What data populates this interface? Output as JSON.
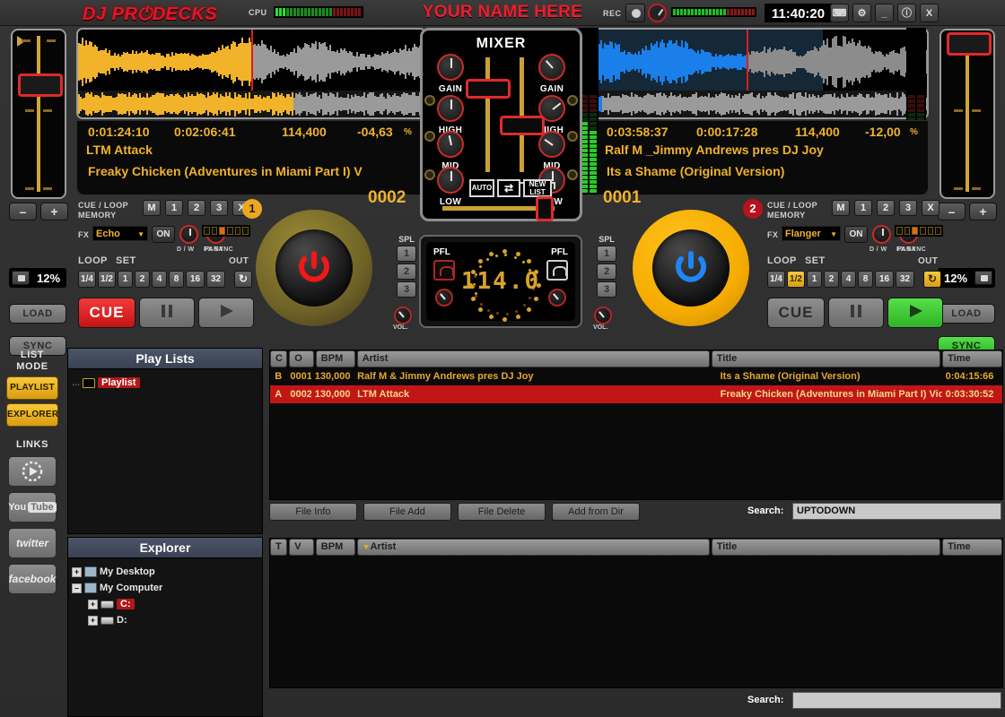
{
  "header": {
    "logo": "DJ PRഠDECKS",
    "logo_text": "DJ PRODECKS",
    "cpu_label": "CPU",
    "your_name": "YOUR NAME HERE",
    "rec_label": "REC",
    "clock": "11:40:20",
    "win_buttons": [
      "⌨",
      "⚙",
      "_",
      "ⓘ",
      "X"
    ],
    "win_button_names": [
      "keyboard-icon",
      "gear-icon",
      "minimize-icon",
      "info-icon",
      "close-icon"
    ]
  },
  "colors": {
    "accent_red": "#e8152a",
    "accent_amber": "#f0b32a",
    "deck_a_wave": "#f0b32a",
    "deck_b_wave": "#1a7fe8",
    "green_on": "#2fb227",
    "selection_red": "#c21616"
  },
  "deck_a": {
    "badge": "1",
    "elapsed": "0:01:24:10",
    "remain": "0:02:06:41",
    "bpm": "114,400",
    "pitch": "-04,63",
    "pitch_unit": "%",
    "artist": "LTM Attack",
    "title": "Freaky Chicken (Adventures in Miami Part I) V",
    "track_number": "0002",
    "pitch_lock": "12%",
    "load_label": "LOAD",
    "sync_label": "SYNC",
    "sync_active": false,
    "minus": "–",
    "plus": "+",
    "cue_loop_label": "CUE / LOOP\nMEMORY",
    "memory_buttons": [
      "M",
      "1",
      "2",
      "3",
      "X"
    ],
    "fx_label": "FX",
    "fx_name": "Echo",
    "fx_on": "ON",
    "fx_dw": "D / W",
    "fx_para": "PARA",
    "fx_sync": "FX SYNC",
    "loop_label": "LOOP",
    "set_label": "SET",
    "out_label": "OUT",
    "loop_buttons": [
      "1/4",
      "1/2",
      "1",
      "2",
      "4",
      "8",
      "16",
      "32"
    ],
    "loop_active": null,
    "cue_label": "CUE",
    "cue_active": true,
    "pause_label": "‖",
    "play_label": "▶",
    "play_active": false,
    "spl_label": "SPL",
    "spl_buttons": [
      "1",
      "2",
      "3"
    ],
    "vol_label": "VOL."
  },
  "deck_b": {
    "badge": "2",
    "elapsed": "0:03:58:37",
    "remain": "0:00:17:28",
    "bpm": "114,400",
    "pitch": "-12,00",
    "pitch_unit": "%",
    "artist": "Ralf M _Jimmy Andrews pres DJ Joy",
    "title": "Its a Shame (Original Version)",
    "track_number": "0001",
    "pitch_lock": "12%",
    "load_label": "LOAD",
    "sync_label": "SYNC",
    "sync_active": true,
    "minus": "–",
    "plus": "+",
    "cue_loop_label": "CUE / LOOP\nMEMORY",
    "memory_buttons": [
      "M",
      "1",
      "2",
      "3",
      "X"
    ],
    "fx_label": "FX",
    "fx_name": "Flanger",
    "fx_on": "ON",
    "fx_dw": "D / W",
    "fx_para": "PARA",
    "fx_sync": "FX SYNC",
    "loop_label": "LOOP",
    "set_label": "SET",
    "out_label": "OUT",
    "loop_buttons": [
      "1/4",
      "1/2",
      "1",
      "2",
      "4",
      "8",
      "16",
      "32"
    ],
    "loop_active": "1/2",
    "cue_label": "CUE",
    "cue_active": false,
    "pause_label": "‖",
    "play_label": "▶",
    "play_active": true,
    "spl_label": "SPL",
    "spl_buttons": [
      "1",
      "2",
      "3"
    ],
    "vol_label": "VOL."
  },
  "mixer": {
    "title": "MIXER",
    "knob_labels": [
      "GAIN",
      "HIGH",
      "MID",
      "LOW"
    ],
    "buttons": [
      "AUTO",
      "⇄",
      "NEW\nLIST"
    ],
    "auto_label": "AUTO",
    "shuffle_label": "⇄",
    "newlist_label": "NEW LIST"
  },
  "bpm_counter": {
    "value": "114.0",
    "pfl_left": "PFL",
    "pfl_right": "PFL"
  },
  "sidebar": {
    "list_mode_label": "LIST\nMODE",
    "list_mode_line1": "LIST",
    "list_mode_line2": "MODE",
    "mode_buttons": [
      {
        "label": "PLAYLIST",
        "name": "playlist",
        "active": true
      },
      {
        "label": "EXPLORER",
        "name": "explorer",
        "active": true
      }
    ],
    "links_label": "LINKS",
    "links": [
      {
        "label": "◌",
        "name": "disc-icon"
      },
      {
        "label": "You Tube",
        "name": "youtube-icon"
      },
      {
        "label": "twitter",
        "name": "twitter-icon"
      },
      {
        "label": "facebook",
        "name": "facebook-icon"
      }
    ]
  },
  "playlists_panel": {
    "title": "Play Lists",
    "items": [
      {
        "label": "Playlist",
        "selected": true
      }
    ]
  },
  "explorer_panel": {
    "title": "Explorer",
    "items": [
      {
        "label": "My Desktop",
        "expander": "+",
        "icon": "computer-icon",
        "indent": 0,
        "selected": false
      },
      {
        "label": "My Computer",
        "expander": "–",
        "icon": "computer-icon",
        "indent": 0,
        "selected": false
      },
      {
        "label": "C:",
        "expander": "+",
        "icon": "harddrive-icon",
        "indent": 1,
        "selected": true
      },
      {
        "label": "D:",
        "expander": "+",
        "icon": "cddrive-icon",
        "indent": 1,
        "selected": false
      }
    ]
  },
  "playlist_table": {
    "columns": [
      "C",
      "O",
      "BPM",
      "Artist",
      "Title",
      "Time"
    ],
    "rows": [
      {
        "c": "B",
        "o": "0001",
        "bpm": "130,000",
        "artist": "Ralf M & Jimmy Andrews pres DJ Joy",
        "title": "Its a Shame (Original Version)",
        "time": "0:04:15:66",
        "selected": false
      },
      {
        "c": "A",
        "o": "0002",
        "bpm": "130,000",
        "artist": "LTM Attack",
        "title": "Freaky Chicken (Adventures in Miami Part I) Video E",
        "time": "0:03:30:52",
        "selected": true
      }
    ]
  },
  "file_toolbar": {
    "buttons": [
      "File Info",
      "File Add",
      "File Delete",
      "Add from Dir"
    ],
    "search_label": "Search:",
    "search_value": "UPTODOWN"
  },
  "browser_table": {
    "columns": [
      "T",
      "V",
      "BPM",
      "Artist",
      "Title",
      "Time"
    ],
    "sort_marker": "▼",
    "rows": [],
    "search_label": "Search:",
    "search_value": ""
  }
}
